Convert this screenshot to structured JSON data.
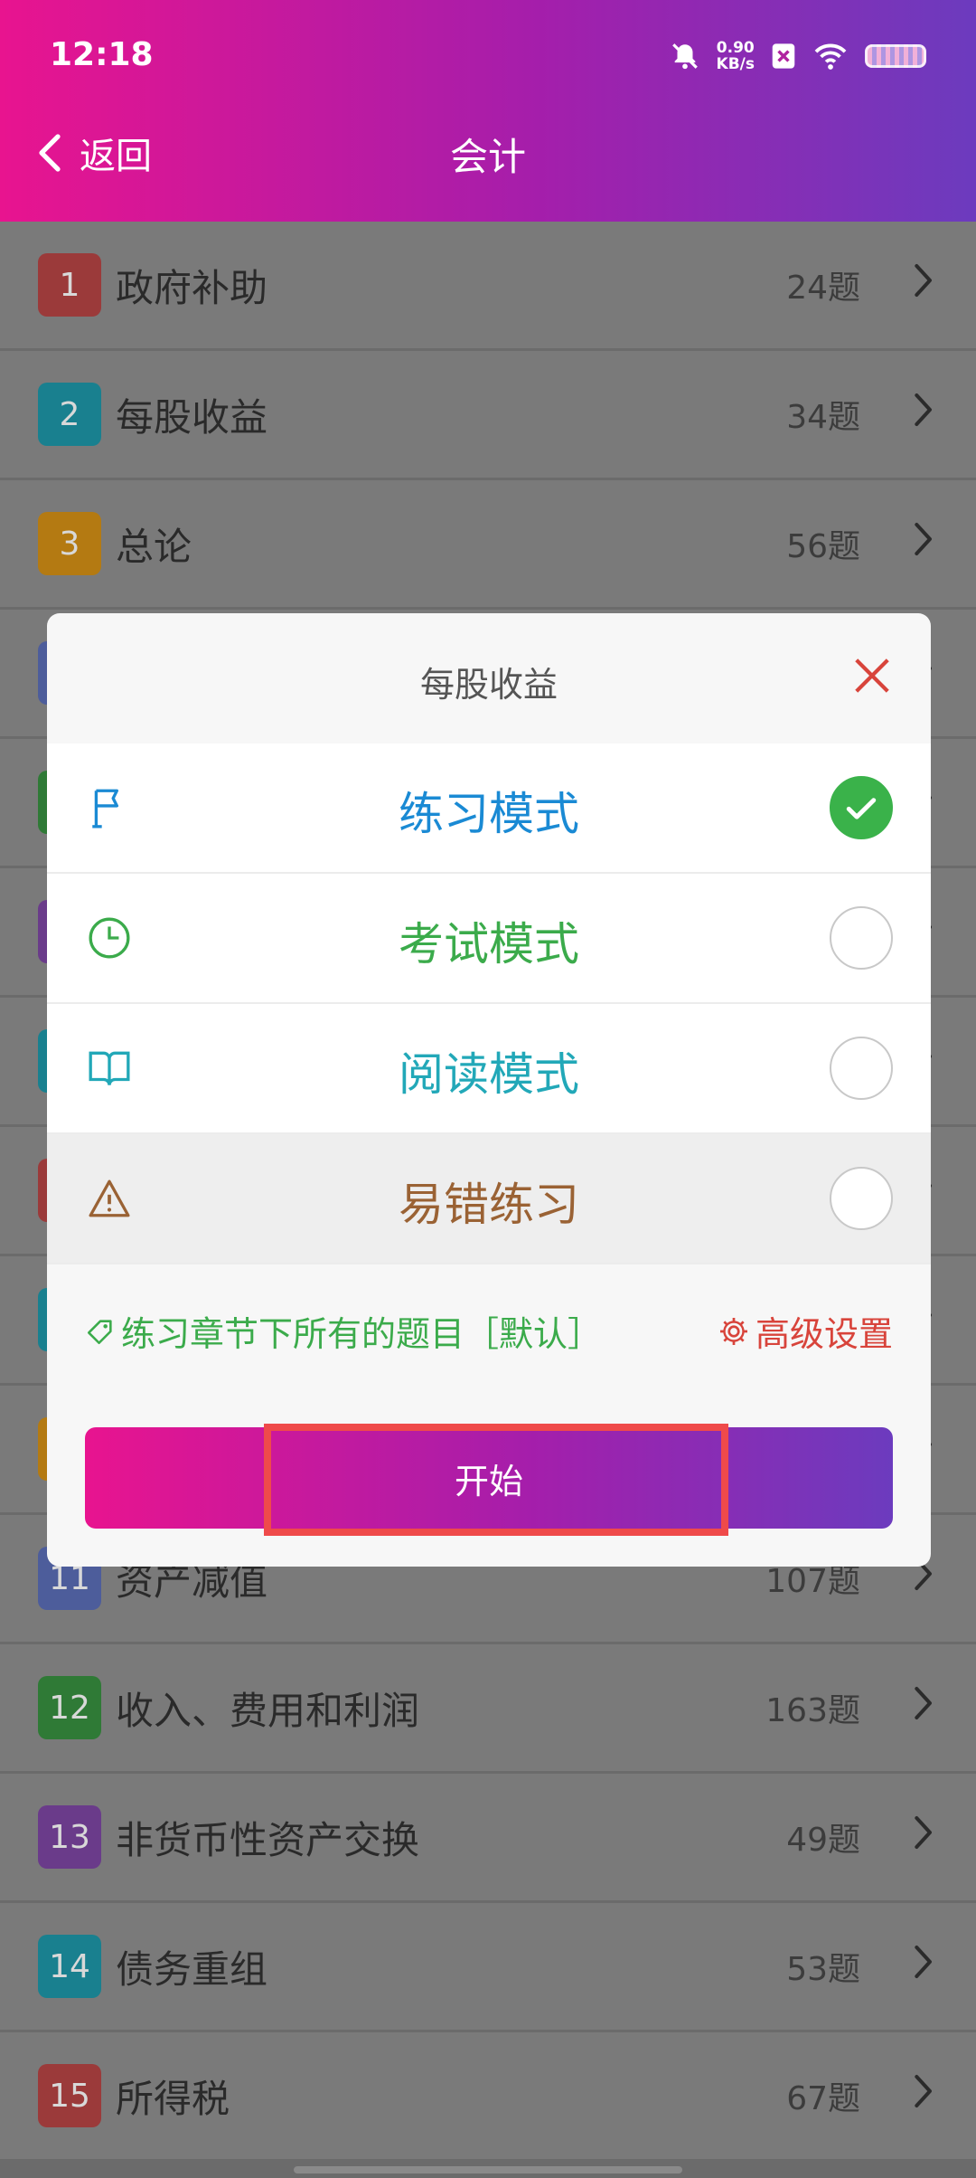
{
  "status": {
    "time": "12:18",
    "net_speed_value": "0.90",
    "net_speed_unit": "KB/s"
  },
  "header": {
    "back_label": "返回",
    "title": "会计"
  },
  "list": [
    {
      "num": "1",
      "title": "政府补助",
      "count": "24题",
      "color": "#9b3a3a"
    },
    {
      "num": "2",
      "title": "每股收益",
      "count": "34题",
      "color": "#19808f"
    },
    {
      "num": "3",
      "title": "总论",
      "count": "56题",
      "color": "#b47a12"
    },
    {
      "num": "",
      "title": "",
      "count": "",
      "color": "#4d5d9b"
    },
    {
      "num": "",
      "title": "",
      "count": "",
      "color": "#2f7a36"
    },
    {
      "num": "",
      "title": "",
      "count": "",
      "color": "#6a3b8a"
    },
    {
      "num": "",
      "title": "",
      "count": "",
      "color": "#19808f"
    },
    {
      "num": "",
      "title": "",
      "count": "",
      "color": "#9b3a3a"
    },
    {
      "num": "",
      "title": "",
      "count": "",
      "color": "#19808f"
    },
    {
      "num": "",
      "title": "",
      "count": "",
      "color": "#b47a12"
    },
    {
      "num": "11",
      "title": "资产减值",
      "count": "107题",
      "color": "#4d5d9b"
    },
    {
      "num": "12",
      "title": "收入、费用和利润",
      "count": "163题",
      "color": "#2f7a36"
    },
    {
      "num": "13",
      "title": "非货币性资产交换",
      "count": "49题",
      "color": "#6a3b8a"
    },
    {
      "num": "14",
      "title": "债务重组",
      "count": "53题",
      "color": "#19808f"
    },
    {
      "num": "15",
      "title": "所得税",
      "count": "67题",
      "color": "#9b3a3a"
    }
  ],
  "modal": {
    "title": "每股收益",
    "modes": [
      {
        "label": "练习模式",
        "color": "#1a8ad4",
        "checked": true
      },
      {
        "label": "考试模式",
        "color": "#3bab4b",
        "checked": false
      },
      {
        "label": "阅读模式",
        "color": "#22a8b8",
        "checked": false
      },
      {
        "label": "易错练习",
        "color": "#9a6234",
        "checked": false
      }
    ],
    "info_left": "练习章节下所有的题目［默认］",
    "info_right": "高级设置",
    "start_label": "开始"
  }
}
